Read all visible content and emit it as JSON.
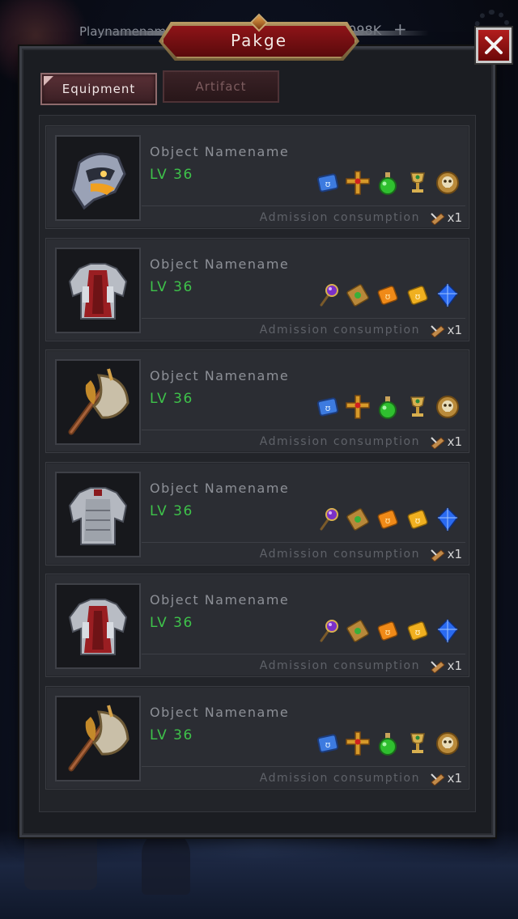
{
  "hud": {
    "player_name": "Playnamename",
    "gold": "9098K",
    "plus": "+"
  },
  "window": {
    "title": "Pakge",
    "close_glyph": "×"
  },
  "tabs": [
    {
      "label": "Equipment",
      "active": true
    },
    {
      "label": "Artifact",
      "active": false
    }
  ],
  "items": [
    {
      "name": "Object Namename",
      "level": "LV 36",
      "thumb": "helmet-icon",
      "rewards": [
        "blue-rune-book-icon",
        "golden-cross-icon",
        "green-potion-icon",
        "golden-chalice-icon",
        "golden-skull-medal-icon"
      ],
      "consume_label": "Admission consumption",
      "consume_qty": "x1"
    },
    {
      "name": "Object Namename",
      "level": "LV 36",
      "thumb": "red-chest-armor-icon",
      "rewards": [
        "purple-orb-staff-icon",
        "scroll-icon",
        "orange-scroll-icon",
        "gold-scroll-icon",
        "blue-crystal-icon"
      ],
      "consume_label": "Admission consumption",
      "consume_qty": "x1"
    },
    {
      "name": "Object Namename",
      "level": "LV 36",
      "thumb": "battle-axe-icon",
      "rewards": [
        "blue-rune-book-icon",
        "golden-cross-icon",
        "green-potion-icon",
        "golden-chalice-icon",
        "golden-skull-medal-icon"
      ],
      "consume_label": "Admission consumption",
      "consume_qty": "x1"
    },
    {
      "name": "Object Namename",
      "level": "LV 36",
      "thumb": "silver-chest-armor-icon",
      "rewards": [
        "purple-orb-staff-icon",
        "scroll-icon",
        "orange-scroll-icon",
        "gold-scroll-icon",
        "blue-crystal-icon"
      ],
      "consume_label": "Admission consumption",
      "consume_qty": "x1"
    },
    {
      "name": "Object Namename",
      "level": "LV 36",
      "thumb": "red-chest-armor-icon",
      "rewards": [
        "purple-orb-staff-icon",
        "scroll-icon",
        "orange-scroll-icon",
        "gold-scroll-icon",
        "blue-crystal-icon"
      ],
      "consume_label": "Admission consumption",
      "consume_qty": "x1"
    },
    {
      "name": "Object Namename",
      "level": "LV 36",
      "thumb": "battle-axe-icon",
      "rewards": [
        "blue-rune-book-icon",
        "golden-cross-icon",
        "green-potion-icon",
        "golden-chalice-icon",
        "golden-skull-medal-icon"
      ],
      "consume_label": "Admission consumption",
      "consume_qty": "x1"
    }
  ],
  "colors": {
    "level_green": "#3ec24a",
    "title_red": "#8e1418",
    "close_red": "#b21d1d"
  }
}
